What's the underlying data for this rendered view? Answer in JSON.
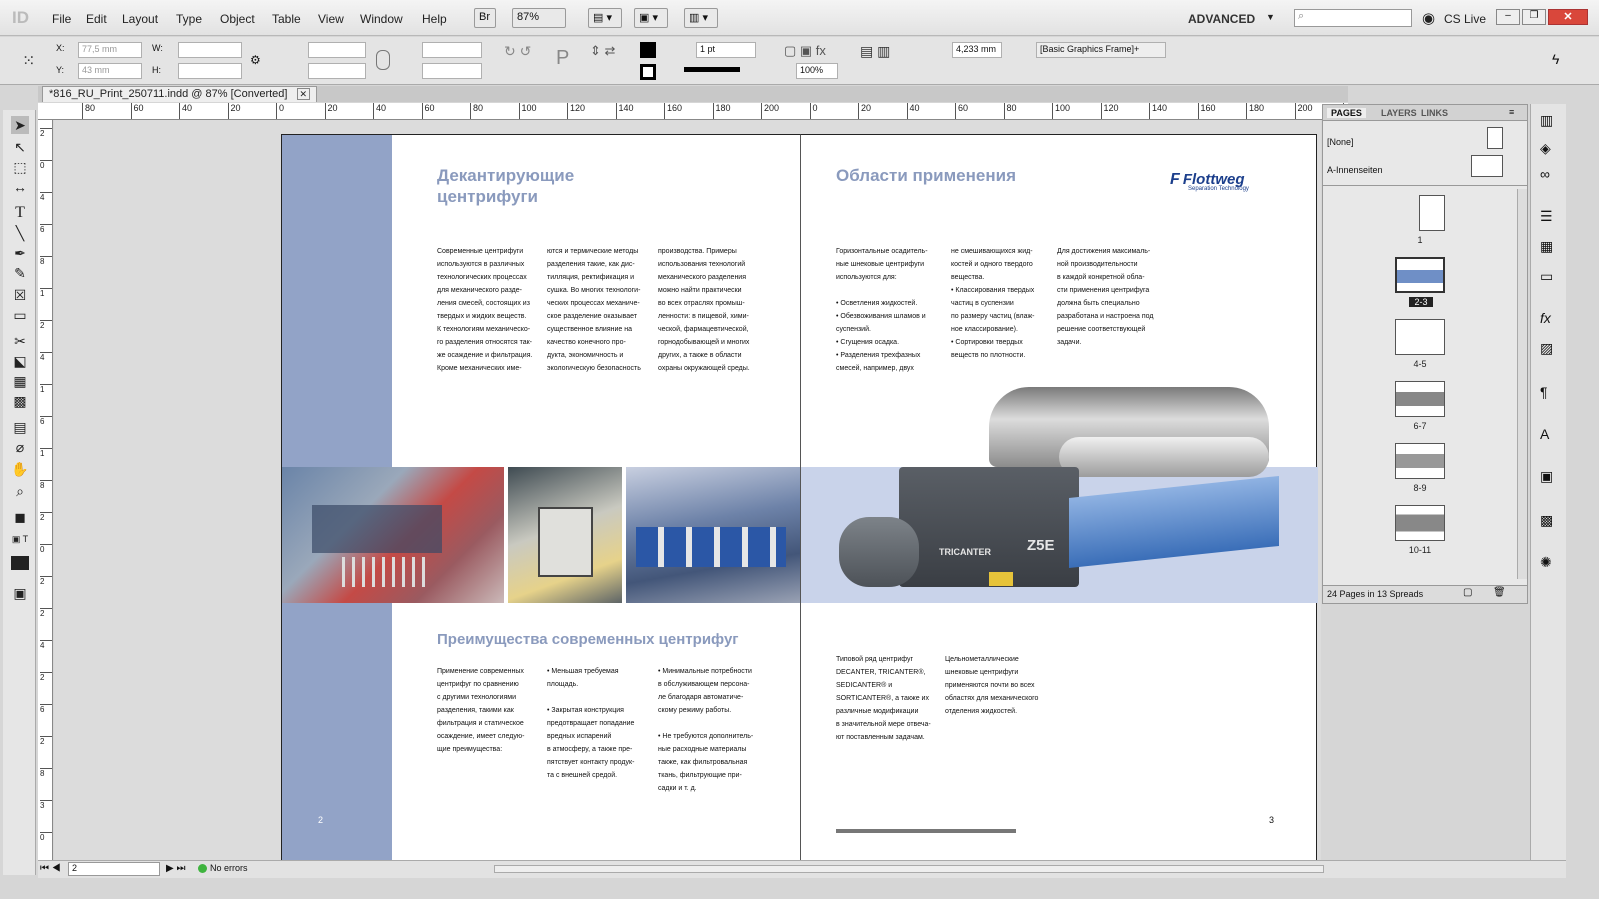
{
  "menubar": {
    "items": [
      "File",
      "Edit",
      "Layout",
      "Type",
      "Object",
      "Table",
      "View",
      "Window",
      "Help"
    ],
    "bridge": "Br",
    "zoom": "87%",
    "workspace": "ADVANCED",
    "cs_live": "CS Live"
  },
  "control": {
    "x": "77,5 mm",
    "y": "43 mm",
    "w_label": "W:",
    "h_label": "H:",
    "x_label": "X:",
    "y_label": "Y:",
    "stroke": "1 pt",
    "opacity": "100%",
    "size": "4,233 mm",
    "style": "[Basic Graphics Frame]+"
  },
  "doc": {
    "tab": "*816_RU_Print_250711.indd @ 87% [Converted]"
  },
  "ruler": {
    "h": [
      "80",
      "60",
      "40",
      "20",
      "0",
      "20",
      "40",
      "60",
      "80",
      "100",
      "120",
      "140",
      "160",
      "180",
      "200",
      "0",
      "20",
      "40",
      "60",
      "80",
      "100",
      "120",
      "140",
      "160",
      "180",
      "200",
      "220"
    ],
    "v": [
      "2",
      "0",
      "4",
      "6",
      "8",
      "1",
      "2",
      "4",
      "1",
      "6",
      "1",
      "8",
      "2",
      "0",
      "2",
      "2",
      "4",
      "2",
      "6",
      "2",
      "8",
      "3",
      "0"
    ]
  },
  "left_page": {
    "title": "Декантирующие\nцентрифуги",
    "col1": "Современные центрифуги\nиспользуются в различных\nтехнологических процессах\nдля механического разде-\nления смесей, состоящих из\nтвердых и жидких веществ.\nК технологиям механическо-\nго разделения относятся так-\nже осаждение и фильтрация.\nКроме механических име-",
    "col2": "ются и термические методы\nразделения такие, как дис-\nтилляция, ректификация и\nсушка. Во многих технологи-\nческих процессах механиче-\nское разделение оказывает\nсущественное влияние на\nкачество конечного про-\nдукта, экономичность и\nэкологическую безопасность",
    "col3": "производства. Примеры\nиспользования технологий\nмеханического разделения\nможно найти практически\nво всех отраслях промыш-\nленности: в пищевой, хими-\nческой, фармацевтической,\nгорнодобывающей и многих\nдругих, а также в области\nохраны окружающей среды.",
    "subtitle": "Преимущества современных центрифуг",
    "adv1": "Применение современных\nцентрифуг по сравнению\nс другими технологиями\nразделения, такими как\nфильтрация и статическое\nосаждение, имеет следую-\nщие преимущества:",
    "adv2": "• Меньшая требуемая\n  площадь.\n\n• Закрытая конструкция\n  предотвращает попадание\n  вредных испарений\n  в атмосферу, а также пре-\n  пятствует контакту продук-\n  та с внешней средой.",
    "adv3": "• Минимальные потребности\n  в обслуживающем персона-\n  ле благодаря автоматиче-\n  скому режиму работы.\n\n• Не требуются дополнитель-\n  ные расходные материалы\n  также, как фильтровальная\n  ткань, фильтрующие при-\n  садки и т. д.",
    "page_num": "2"
  },
  "right_page": {
    "title": "Области применения",
    "logo": "Flottweg",
    "logo_sub": "Separation Technology",
    "col1": "Горизонтальные осадитель-\nные шнековые центрифуги\nиспользуются для:\n\n• Осветления жидкостей.\n• Обезвоживания шламов и\n  суспензий.\n• Сгущения осадка.\n• Разделения трехфазных\n  смесей, например, двух",
    "col2": "не смешивающихся жид-\nкостей и одного твердого\nвещества.\n• Классирования твердых\n  частиц в суспензии\n  по размеру частиц (влаж-\n  ное классирование).\n• Сортировки твердых\n  веществ по плотности.",
    "col3": "Для достижения максималь-\nной производительности\nв каждой конкретной обла-\nсти применения центрифуга\nдолжна быть специально\nразработана и настроена под\nрешение соответствующей\nзадачи.",
    "bottom1": "Типовой ряд центрифуг\nDECANTER, TRICANTER®,\nSEDICANTER® и\nSORTICANTER®, а также их\nразличные модификации\nв значительной мере отвеча-\nют поставленным задачам.",
    "bottom2": "Цельнометаллические\nшнековые центрифуги\nприменяются почти во всех\nобластях для механического\nотделения жидкостей.",
    "machine_label": "TRICANTER",
    "machine_model": "Z5E",
    "page_num": "3"
  },
  "panel": {
    "tabs": [
      "PAGES",
      "LAYERS",
      "LINKS"
    ],
    "none": "[None]",
    "master": "A-Innenseiten",
    "thumbs": [
      "1",
      "2-3",
      "4-5",
      "6-7",
      "8-9",
      "10-11"
    ],
    "footer": "24 Pages in 13 Spreads"
  },
  "status": {
    "page": "2",
    "errors": "No errors"
  }
}
